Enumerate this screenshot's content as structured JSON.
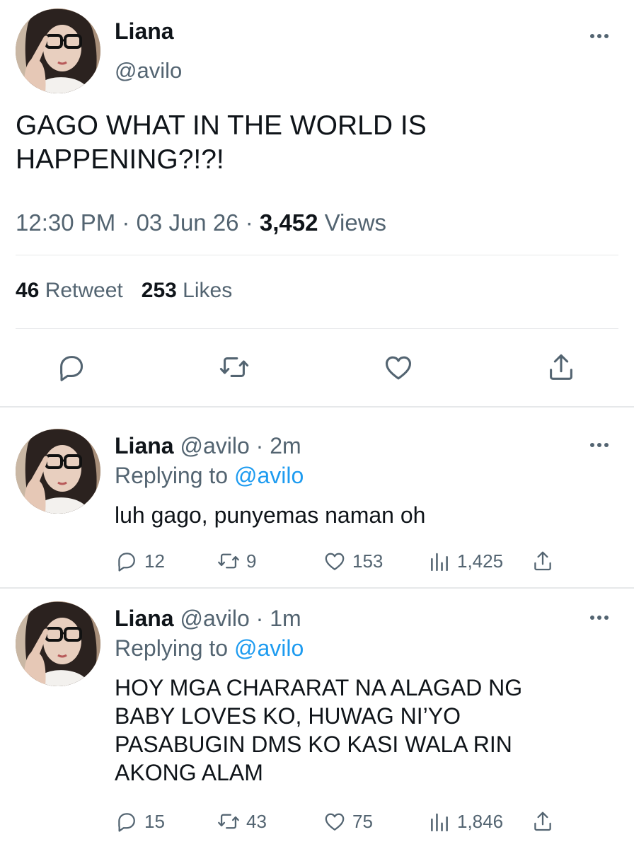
{
  "tweet": {
    "name": "Liana",
    "handle": "@avilo",
    "text": "GAGO WHAT IN THE WORLD IS HAPPENING?!?!",
    "time": "12:30 PM · 03 Jun 26 · ",
    "views_count": "3,452",
    "views_label": " Views",
    "retweets_count": "46",
    "retweets_label": " Retweet",
    "likes_count": "253",
    "likes_label": " Likes",
    "icons": [
      "comment-icon",
      "retweet-icon",
      "like-icon",
      "share-icon"
    ]
  },
  "replies": [
    {
      "name": "Liana",
      "handle": "@avilo",
      "time": " · 2m",
      "replying_label": "Replying to ",
      "replying_to": "@avilo",
      "text": "luh gago, punyemas naman oh",
      "replies": "12",
      "retweets": "9",
      "likes": "153",
      "views": "1,425"
    },
    {
      "name": "Liana",
      "handle": "@avilo",
      "time": " · 1m",
      "replying_label": "Replying to ",
      "replying_to": "@avilo",
      "text": "HOY MGA CHARARAT NA ALAGAD NG BABY LOVES KO, HUWAG NI’YO PASABUGIN DMS KO KASI WALA RIN AKONG ALAM",
      "replies": "15",
      "retweets": "43",
      "likes": "75",
      "views": "1,846"
    }
  ],
  "colors": {
    "text": "#0f1419",
    "secondary": "#536471",
    "link": "#1d9bf0",
    "divider": "#e6e8ea"
  }
}
